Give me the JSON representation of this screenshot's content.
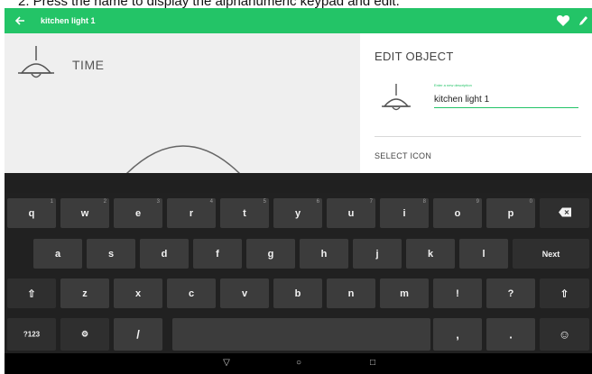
{
  "caption": "2.   Press the name to display the alphanumeric keypad and edit.",
  "appbar": {
    "title": "kitchen light 1",
    "back_icon": "arrow-left-icon",
    "favorite_icon": "heart-icon",
    "edit_icon": "pencil-icon",
    "color": "#23c467"
  },
  "left": {
    "label": "TIME",
    "icon": "ceiling-lamp-icon"
  },
  "edit": {
    "heading": "EDIT OBJECT",
    "hint": "Enter a new description",
    "value": "kitchen light 1",
    "select_icon": "SELECT ICON",
    "icon": "ceiling-lamp-icon"
  },
  "keyboard": {
    "row1": [
      {
        "l": "q",
        "h": "1"
      },
      {
        "l": "w",
        "h": "2"
      },
      {
        "l": "e",
        "h": "3"
      },
      {
        "l": "r",
        "h": "4"
      },
      {
        "l": "t",
        "h": "5"
      },
      {
        "l": "y",
        "h": "6"
      },
      {
        "l": "u",
        "h": "7"
      },
      {
        "l": "i",
        "h": "8"
      },
      {
        "l": "o",
        "h": "9"
      },
      {
        "l": "p",
        "h": "0"
      }
    ],
    "row2": [
      "a",
      "s",
      "d",
      "f",
      "g",
      "h",
      "j",
      "k",
      "l"
    ],
    "row3": [
      "z",
      "x",
      "c",
      "v",
      "b",
      "n",
      "m",
      "!",
      "?"
    ],
    "next_label": "Next",
    "sym_label": "?123",
    "emoji_label": "☺",
    "settings_label": "⚙",
    "slash_label": "/",
    "comma_label": ",",
    "period_label": ".",
    "shift_label": "⇧",
    "backspace_icon": "backspace-icon"
  },
  "navbar": {
    "back": "▽",
    "home": "○",
    "recents": "□"
  }
}
